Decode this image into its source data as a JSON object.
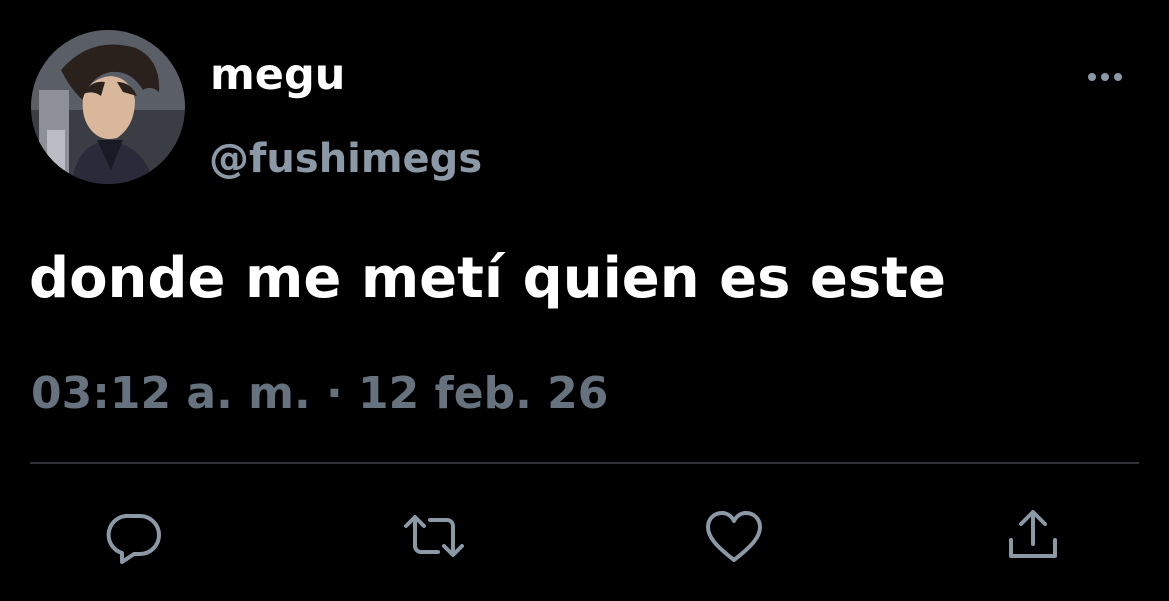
{
  "author": {
    "display_name": "megu",
    "handle": "@fushimegs",
    "avatar_icon": "avatar-anime-character"
  },
  "tweet": {
    "text": "donde me metí quien es este",
    "time": "03:12 a. m.",
    "separator": "·",
    "date": "12 feb. 26"
  },
  "header": {
    "more_icon": "more-options-icon"
  },
  "actions": [
    {
      "name": "reply",
      "icon": "reply-icon"
    },
    {
      "name": "retweet",
      "icon": "retweet-icon"
    },
    {
      "name": "like",
      "icon": "heart-icon"
    },
    {
      "name": "share",
      "icon": "share-icon"
    }
  ],
  "colors": {
    "background": "#000000",
    "primary_text": "#ffffff",
    "secondary_text": "#8b98a5",
    "meta_text": "#66727d",
    "divider": "#2f3336",
    "icon": "#8b98a5"
  }
}
